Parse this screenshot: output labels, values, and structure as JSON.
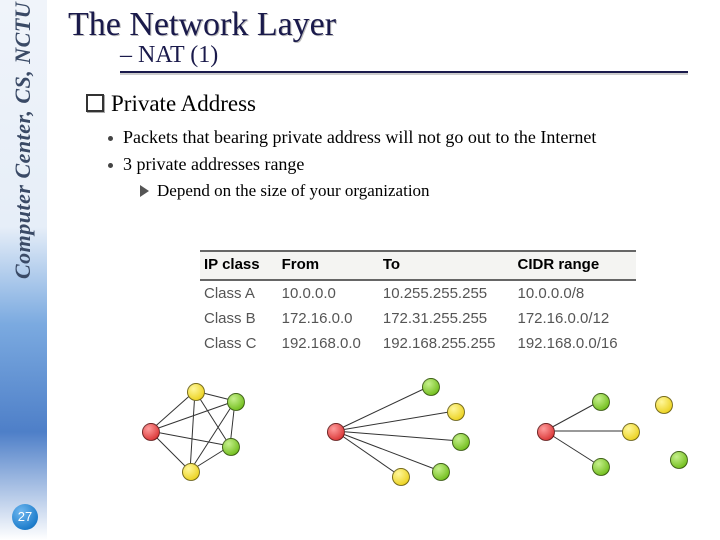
{
  "sidebar": {
    "label": "Computer Center, CS, NCTU"
  },
  "page_number": "27",
  "title": "The Network Layer",
  "subtitle": "– NAT (1)",
  "main_bullet": "Private Address",
  "sub_bullets": {
    "b1": "Packets that bearing private address will not go out to the Internet",
    "b2": "3 private addresses range",
    "b2a": "Depend on the size of your organization"
  },
  "chart_data": {
    "type": "table",
    "headers": {
      "h1": "IP class",
      "h2": "From",
      "h3": "To",
      "h4": "CIDR range"
    },
    "rows": [
      {
        "c1": "Class A",
        "c2": "10.0.0.0",
        "c3": "10.255.255.255",
        "c4": "10.0.0.0/8"
      },
      {
        "c1": "Class B",
        "c2": "172.16.0.0",
        "c3": "172.31.255.255",
        "c4": "172.16.0.0/12"
      },
      {
        "c1": "Class C",
        "c2": "192.168.0.0",
        "c3": "192.168.255.255",
        "c4": "192.168.0.0/16"
      }
    ]
  }
}
